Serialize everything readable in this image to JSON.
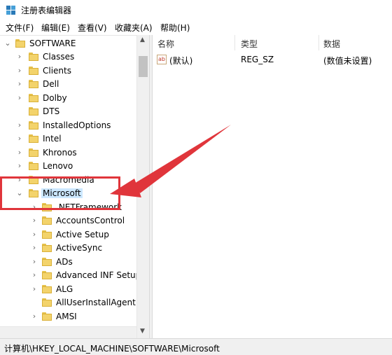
{
  "window": {
    "title": "注册表编辑器",
    "app_icon": "regedit-icon"
  },
  "menu": [
    "文件(F)",
    "编辑(E)",
    "查看(V)",
    "收藏夹(A)",
    "帮助(H)"
  ],
  "tree": {
    "root": "SOFTWARE",
    "top_items": [
      "Classes",
      "Clients",
      "Dell",
      "Dolby",
      "DTS",
      "InstalledOptions",
      "Intel",
      "Khronos",
      "Lenovo",
      "Macromedia"
    ],
    "selected": "Microsoft",
    "children": [
      ".NETFramework",
      "AccountsControl",
      "Active Setup",
      "ActiveSync",
      "ADs",
      "Advanced INF Setup",
      "ALG",
      "AllUserInstallAgent",
      "AMSI"
    ]
  },
  "list": {
    "headers": {
      "name": "名称",
      "type": "类型",
      "data": "数据"
    },
    "rows": [
      {
        "name": "(默认)",
        "type": "REG_SZ",
        "data": "(数值未设置)",
        "icon": "string-value-icon"
      }
    ]
  },
  "status": {
    "path": "计算机\\HKEY_LOCAL_MACHINE\\SOFTWARE\\Microsoft"
  },
  "annotation": {
    "highlight_color": "#e0353b"
  }
}
